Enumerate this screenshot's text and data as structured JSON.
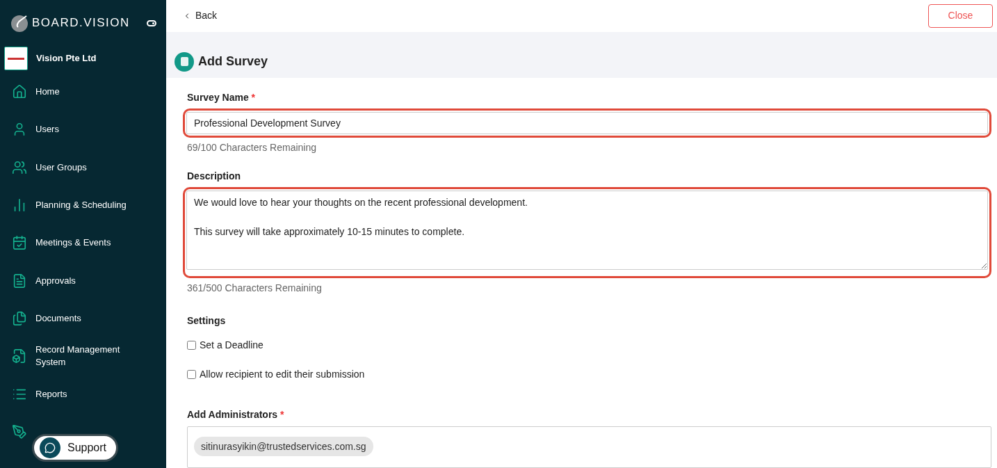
{
  "brand": "BOARD.VISION",
  "org": {
    "name": "Vision Pte Ltd"
  },
  "sidebar": {
    "items": [
      {
        "label": "Home"
      },
      {
        "label": "Users"
      },
      {
        "label": "User Groups"
      },
      {
        "label": "Planning & Scheduling"
      },
      {
        "label": "Meetings & Events"
      },
      {
        "label": "Approvals"
      },
      {
        "label": "Documents"
      },
      {
        "label": "Record Management System"
      },
      {
        "label": "Reports"
      }
    ]
  },
  "support": {
    "label": "Support"
  },
  "back": "Back",
  "close": "Close",
  "page_title": "Add Survey",
  "fields": [
    {
      "kind": "input",
      "label": "Survey Name",
      "required_mark": "*",
      "value": "Professional Development Survey",
      "hint": "69/100 Characters Remaining",
      "highlighted": true
    },
    {
      "kind": "textarea",
      "label": "Description",
      "value": "We would love to hear your thoughts on the recent professional development.\n\nThis survey will take approximately 10-15 minutes to complete.",
      "hint": "361/500 Characters Remaining",
      "highlighted": true
    }
  ],
  "settings": {
    "title": "Settings",
    "options": [
      {
        "label": "Set a Deadline",
        "checked": false
      },
      {
        "label": "Allow recipient to edit their submission",
        "checked": false
      }
    ]
  },
  "administrators": {
    "label": "Add Administrators",
    "required_mark": "*",
    "chips": [
      "sitinurasyikin@trustedservices.com.sg"
    ]
  }
}
